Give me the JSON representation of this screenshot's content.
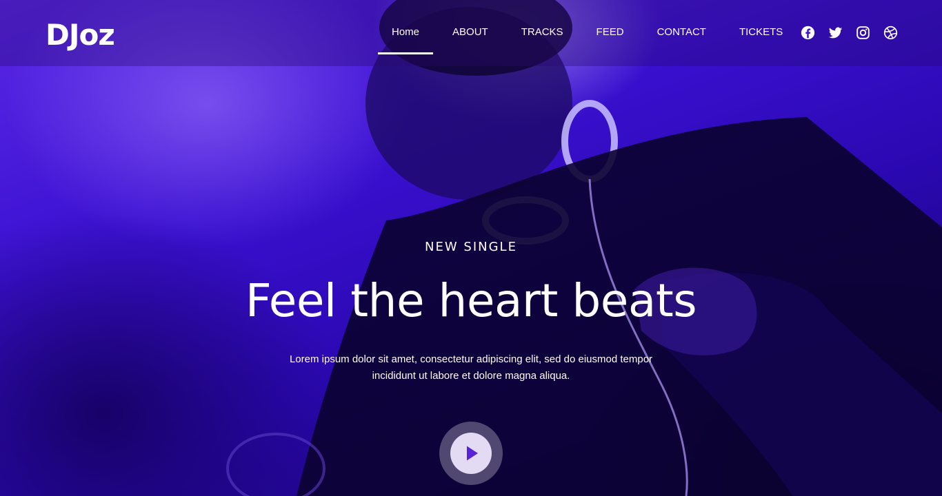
{
  "brand": {
    "logo": "DJoz"
  },
  "nav": {
    "items": [
      {
        "label": "Home",
        "active": true
      },
      {
        "label": "ABOUT",
        "active": false
      },
      {
        "label": "TRACKS",
        "active": false
      },
      {
        "label": "FEED",
        "active": false
      },
      {
        "label": "CONTACT",
        "active": false
      },
      {
        "label": "TICKETS",
        "active": false
      }
    ]
  },
  "social": [
    "facebook-icon",
    "twitter-icon",
    "instagram-icon",
    "dribbble-icon"
  ],
  "hero": {
    "eyebrow": "NEW SINGLE",
    "headline": "Feel the heart beats",
    "lede_line1": "Lorem ipsum dolor sit amet, consectetur adipiscing elit, sed do eiusmod tempor",
    "lede_line2": "incididunt ut labore et dolore magna aliqua."
  },
  "colors": {
    "accent": "#5b21d6",
    "overlay": "#3a10d0"
  }
}
